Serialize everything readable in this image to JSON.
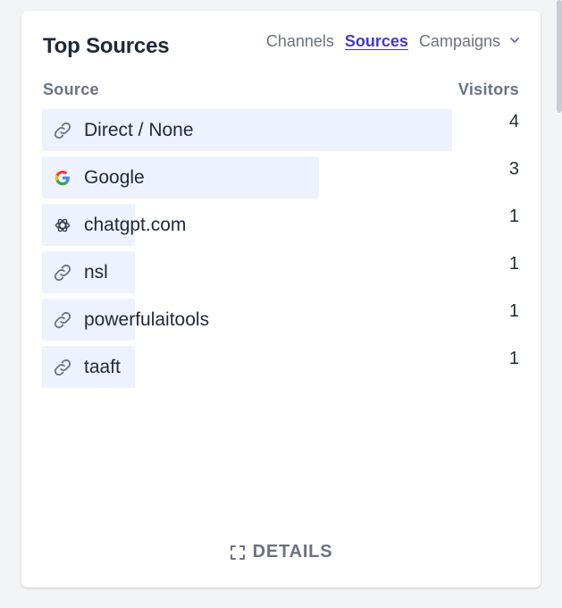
{
  "widget": {
    "title": "Top Sources",
    "tabs": [
      {
        "label": "Channels",
        "active": false
      },
      {
        "label": "Sources",
        "active": true
      },
      {
        "label": "Campaigns",
        "active": false
      }
    ],
    "columns": {
      "source": "Source",
      "visitors": "Visitors"
    },
    "rows": [
      {
        "label": "Direct / None",
        "value": "4",
        "icon": "link-icon",
        "fraction": 0.86
      },
      {
        "label": "Google",
        "value": "3",
        "icon": "google-icon",
        "fraction": 0.58
      },
      {
        "label": "chatgpt.com",
        "value": "1",
        "icon": "openai-icon",
        "fraction": 0.195
      },
      {
        "label": "nsl",
        "value": "1",
        "icon": "link-icon",
        "fraction": 0.195
      },
      {
        "label": "powerfulaitools",
        "value": "1",
        "icon": "link-icon",
        "fraction": 0.195
      },
      {
        "label": "taaft",
        "value": "1",
        "icon": "link-icon",
        "fraction": 0.195
      }
    ],
    "details_label": "DETAILS"
  },
  "colors": {
    "bar": "#eef2ff",
    "active_tab": "#4338ca",
    "muted": "#6b7280",
    "text": "#1f2937"
  }
}
